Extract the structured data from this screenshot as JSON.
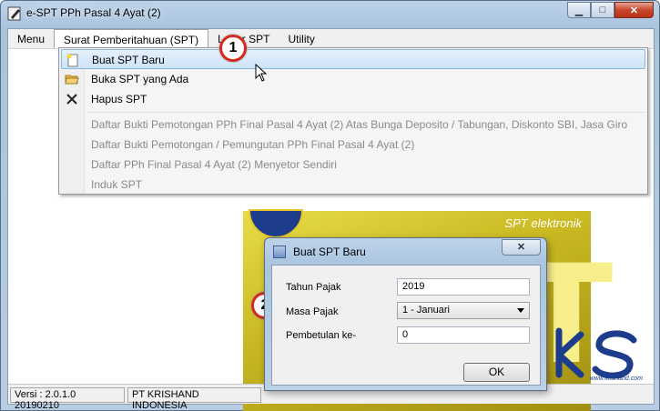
{
  "window": {
    "title": "e-SPT PPh Pasal 4 Ayat (2)",
    "minimize": "▁",
    "maximize": "□",
    "close": "✕"
  },
  "menubar": [
    {
      "label": "Menu"
    },
    {
      "label": "Surat Pemberitahuan (SPT)"
    },
    {
      "label": "Lapor SPT"
    },
    {
      "label": "Utility"
    }
  ],
  "dropdown": {
    "items": [
      {
        "label": "Buat SPT Baru",
        "icon": "new-document-icon",
        "highlighted": true,
        "enabled": true
      },
      {
        "label": "Buka SPT yang Ada",
        "icon": "open-folder-icon",
        "enabled": true
      },
      {
        "label": "Hapus SPT",
        "icon": "delete-x-icon",
        "enabled": true
      },
      {
        "label": "Daftar Bukti Pemotongan PPh Final Pasal 4 Ayat (2) Atas Bunga Deposito / Tabungan, Diskonto SBI, Jasa Giro",
        "enabled": false
      },
      {
        "label": "Daftar Bukti Pemotongan / Pemungutan PPh Final Pasal 4 Ayat (2)",
        "enabled": false
      },
      {
        "label": "Daftar PPh Final Pasal 4 Ayat (2) Menyetor Sendiri",
        "enabled": false
      },
      {
        "label": "Induk SPT",
        "enabled": false
      }
    ]
  },
  "badges": {
    "step1": "1",
    "step2": "2"
  },
  "banner": {
    "subtitle": "SPT elektronik",
    "letters": "SPT"
  },
  "dialog": {
    "title": "Buat SPT Baru",
    "close": "✕",
    "fields": {
      "tahun_pajak_label": "Tahun Pajak",
      "tahun_pajak_value": "2019",
      "masa_pajak_label": "Masa Pajak",
      "masa_pajak_value": "1 - Januari",
      "pembetulan_label": "Pembetulan ke-",
      "pembetulan_value": "0"
    },
    "ok_label": "OK"
  },
  "statusbar": {
    "version": "Versi : 2.0.1.0 20190210",
    "company": "PT KRISHAND INDONESIA"
  },
  "watermark": {
    "logo_text": "KS",
    "url": "www.krishand.com"
  },
  "colors": {
    "highlight": "#cde4f9",
    "badge_border": "#d42a1f",
    "banner": "#c9b822"
  }
}
